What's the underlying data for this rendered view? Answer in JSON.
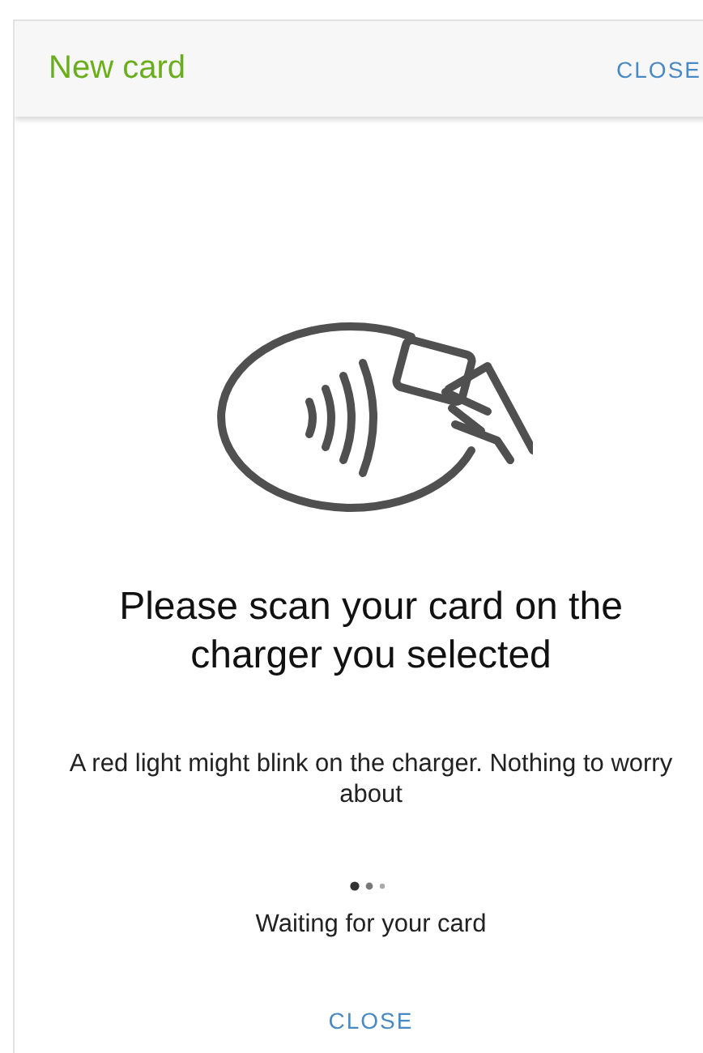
{
  "dialog": {
    "title": "New card",
    "header_action": "CLOSE"
  },
  "content": {
    "heading": "Please scan your card on the charger you selected",
    "message": "A red light might blink on the charger. Nothing to worry about",
    "status": "Waiting for your card"
  },
  "footer_action": "CLOSE"
}
